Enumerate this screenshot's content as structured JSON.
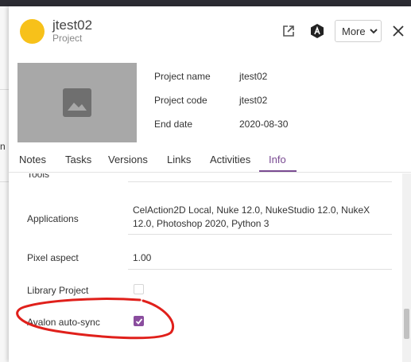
{
  "background_fragment": "n",
  "header": {
    "title": "jtest02",
    "subtitle": "Project",
    "more_label": "More",
    "avatar_color": "#f7c11a"
  },
  "info": {
    "rows": [
      {
        "label": "Project name",
        "value": "jtest02"
      },
      {
        "label": "Project code",
        "value": "jtest02"
      },
      {
        "label": "End date",
        "value": "2020-08-30"
      }
    ]
  },
  "tabs": [
    "Notes",
    "Tasks",
    "Versions",
    "Links",
    "Activities",
    "Info"
  ],
  "active_tab": "Info",
  "accent_color": "#7a4b92",
  "fields": {
    "partial_label": "Tools",
    "applications_label": "Applications",
    "applications_value": "CelAction2D Local, Nuke 12.0, NukeStudio 12.0, NukeX 12.0, Photoshop 2020, Python 3",
    "pixel_aspect_label": "Pixel aspect",
    "pixel_aspect_value": "1.00",
    "library_label": "Library Project",
    "library_checked": false,
    "avalon_label": "Avalon auto-sync",
    "avalon_checked": true
  },
  "annotation_color": "#e0201b"
}
